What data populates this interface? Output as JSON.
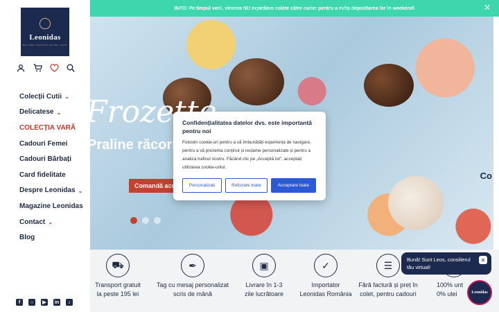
{
  "brand": {
    "name": "Leonidas",
    "tagline": "MAITRE CHOCOLATIER 1913"
  },
  "header_icons": [
    "user-icon",
    "cart-icon",
    "heart-icon",
    "search-icon"
  ],
  "nav": [
    {
      "label": "Colecții Cutii",
      "has_dropdown": true
    },
    {
      "label": "Delicatese",
      "has_dropdown": true
    },
    {
      "label": "COLECȚIA VARĂ",
      "has_dropdown": false,
      "active": true
    },
    {
      "label": "Cadouri Femei",
      "has_dropdown": false
    },
    {
      "label": "Cadouri Bărbați",
      "has_dropdown": false
    },
    {
      "label": "Card fidelitate",
      "has_dropdown": false
    },
    {
      "label": "Despre Leonidas",
      "has_dropdown": true
    },
    {
      "label": "Magazine Leonidas",
      "has_dropdown": false
    },
    {
      "label": "Contact",
      "has_dropdown": true
    },
    {
      "label": "Blog",
      "has_dropdown": false
    }
  ],
  "social": [
    "facebook-icon",
    "instagram-icon",
    "youtube-icon",
    "linkedin-icon",
    "tiktok-icon"
  ],
  "announcement": {
    "text": "INFO! Pe timpul verii, vinerea NU expediem colete către curier pentru a evita depozitarea lor în weekend!",
    "bg_color": "#3ed6ac"
  },
  "hero": {
    "title": "Frozette",
    "subtitle": "Praline răcoritoare",
    "cta": "Comandă acum",
    "slides": 3,
    "active_slide": 1,
    "next_peek": "Co"
  },
  "features": [
    {
      "icon": "truck-icon",
      "line1": "Transport gratuit",
      "line2": "la peste 195 lei"
    },
    {
      "icon": "pen-icon",
      "line1": "Tag cu mesaj personalizat",
      "line2": "scris de mână"
    },
    {
      "icon": "box-icon",
      "line1": "Livrare în 1-3",
      "line2": "zile lucrătoare"
    },
    {
      "icon": "badge-icon",
      "line1": "Importator",
      "line2": "Leonidas România"
    },
    {
      "icon": "receipt-icon",
      "line1": "Fără factură și preț în",
      "line2": "colet, pentru cadouri"
    },
    {
      "icon": "chocolate-icon",
      "line1": "100% unt",
      "line2": "0% ulei"
    }
  ],
  "cookie": {
    "title": "Confidențialitatea datelor dvs. este importantă pentru noi",
    "body": "Folosim cookie-uri pentru a vă îmbunătăți experiența de navigare, pentru a vă prezenta conținut și reclame personalizate și pentru a analiza traficul nostru. Făcând clic pe „Acceptă tot”, acceptați utilizarea cookie-urilor.",
    "customize": "Personalizați",
    "reject": "Refuzare toate",
    "accept": "Acceptare toate",
    "accent_color": "#2b5ad6"
  },
  "chat": {
    "message": "Bună! Sunt Leos, consilierul tău virtual!",
    "avatar_label": "Leonidas"
  },
  "colors": {
    "navy": "#1c2a4f",
    "accent_red": "#c3412f",
    "mint": "#3ed6ac"
  }
}
